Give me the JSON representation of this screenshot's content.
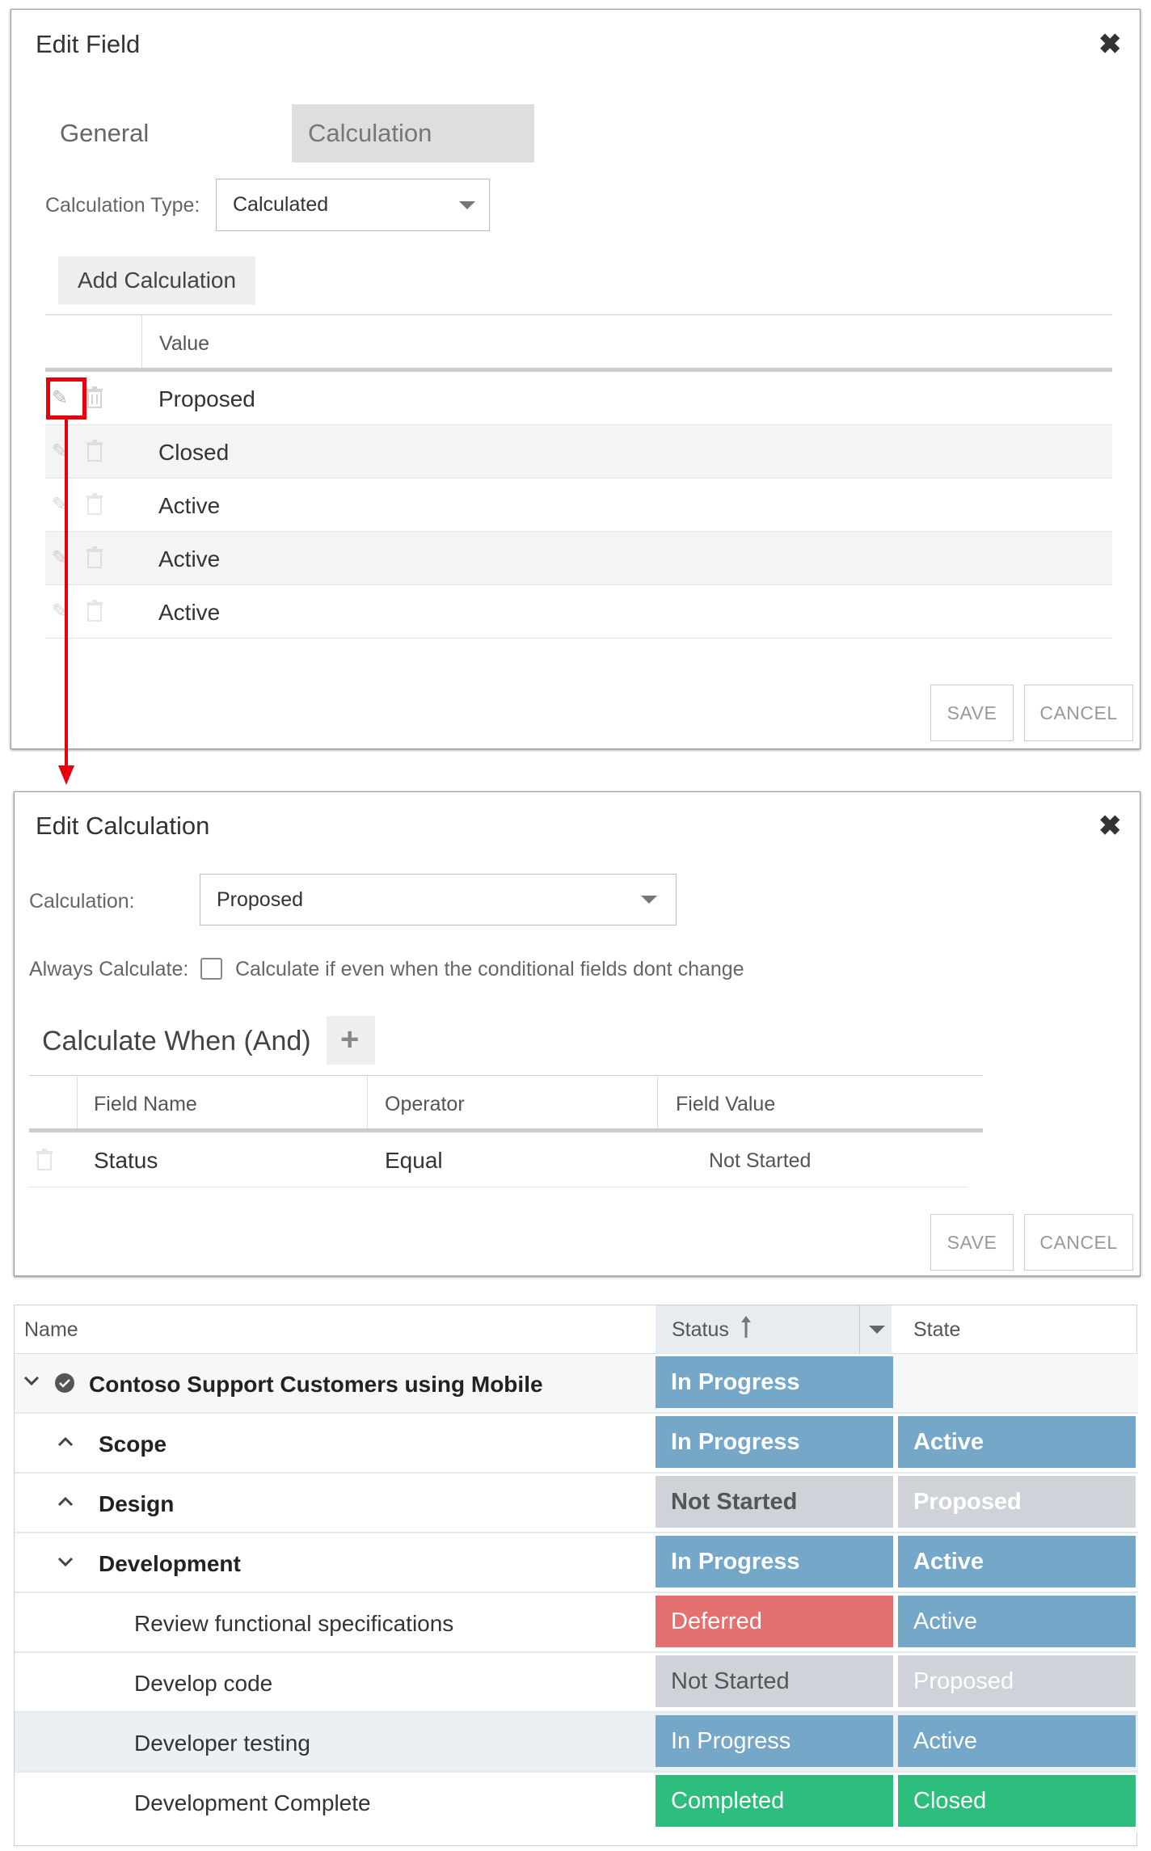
{
  "edit_field": {
    "title": "Edit Field",
    "tabs": [
      {
        "label": "General",
        "active": false
      },
      {
        "label": "Calculation",
        "active": true
      }
    ],
    "calc_type_label": "Calculation Type:",
    "calc_type_value": "Calculated",
    "add_button": "Add Calculation",
    "col_value": "Value",
    "rows": [
      "Proposed",
      "Closed",
      "Active",
      "Active",
      "Active"
    ],
    "save": "SAVE",
    "cancel": "CANCEL"
  },
  "edit_calc": {
    "title": "Edit Calculation",
    "calc_label": "Calculation:",
    "calc_value": "Proposed",
    "always_label": "Always Calculate:",
    "always_checked": false,
    "always_text": "Calculate if even when the conditional fields dont change",
    "when_title": "Calculate When (And)",
    "columns": [
      "Field Name",
      "Operator",
      "Field Value"
    ],
    "rows": [
      {
        "field": "Status",
        "operator": "Equal",
        "value": "Not Started"
      }
    ],
    "save": "SAVE",
    "cancel": "CANCEL"
  },
  "grid": {
    "col_name": "Name",
    "col_status": "Status",
    "col_state": "State",
    "rows": [
      {
        "name": "Contoso Support Customers using Mobile",
        "status": "In Progress",
        "state": "",
        "toggle": "down",
        "check": true,
        "bold": true
      },
      {
        "name": "Scope",
        "status": "In Progress",
        "state": "Active",
        "toggle": "up",
        "bold": true
      },
      {
        "name": "Design",
        "status": "Not Started",
        "state": "Proposed",
        "toggle": "up",
        "bold": true
      },
      {
        "name": "Development",
        "status": "In Progress",
        "state": "Active",
        "toggle": "down",
        "bold": true
      },
      {
        "name": "Review functional specifications",
        "status": "Deferred",
        "state": "Active",
        "bold": false
      },
      {
        "name": "Develop code",
        "status": "Not Started",
        "state": "Proposed",
        "bold": false
      },
      {
        "name": "Developer testing",
        "status": "In Progress",
        "state": "Active",
        "bold": false,
        "highlight": true
      },
      {
        "name": "Development Complete",
        "status": "Completed",
        "state": "Closed",
        "bold": false
      }
    ]
  },
  "colors": {
    "in_progress": "#75a7c8",
    "not_started": "#cfd2d8",
    "deferred": "#e57070",
    "completed": "#2dbd7c",
    "arrow": "#e8000b"
  },
  "icons": [
    "close-icon",
    "chevron-down-icon",
    "pencil-icon",
    "trash-icon",
    "plus-icon",
    "sort-up-icon",
    "check-circle-icon",
    "chevron-up-icon"
  ]
}
